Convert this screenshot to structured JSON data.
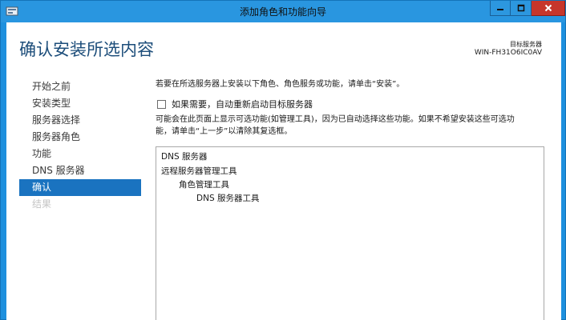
{
  "window": {
    "title": "添加角色和功能向导",
    "controls": {
      "minimize": "minimize",
      "maximize": "maximize",
      "close": "close"
    }
  },
  "header": {
    "title": "确认安装所选内容",
    "target_label": "目标服务器",
    "target_server": "WIN-FH31O6IC0AV"
  },
  "nav": {
    "items": [
      {
        "label": "开始之前",
        "state": "normal"
      },
      {
        "label": "安装类型",
        "state": "normal"
      },
      {
        "label": "服务器选择",
        "state": "normal"
      },
      {
        "label": "服务器角色",
        "state": "normal"
      },
      {
        "label": "功能",
        "state": "normal"
      },
      {
        "label": "DNS 服务器",
        "state": "normal"
      },
      {
        "label": "确认",
        "state": "active"
      },
      {
        "label": "结果",
        "state": "disabled"
      }
    ]
  },
  "content": {
    "intro": "若要在所选服务器上安装以下角色、角色服务或功能，请单击“安装”。",
    "restart_checkbox": {
      "label": "如果需要，自动重新启动目标服务器",
      "checked": false
    },
    "note_line1": "可能会在此页面上显示可选功能(如管理工具)，因为已自动选择这些功能。如果不希望安装这些可选功",
    "note_line2": "能，请单击“上一步”以清除其复选框。",
    "selections": [
      {
        "label": "DNS 服务器",
        "level": 0
      },
      {
        "label": "远程服务器管理工具",
        "level": 0
      },
      {
        "label": "角色管理工具",
        "level": 1
      },
      {
        "label": "DNS 服务器工具",
        "level": 2
      }
    ]
  },
  "colors": {
    "titlebar": "#2996e0",
    "close_button": "#c7362b",
    "active_nav": "#1a73c0",
    "heading": "#1c4d7a"
  }
}
